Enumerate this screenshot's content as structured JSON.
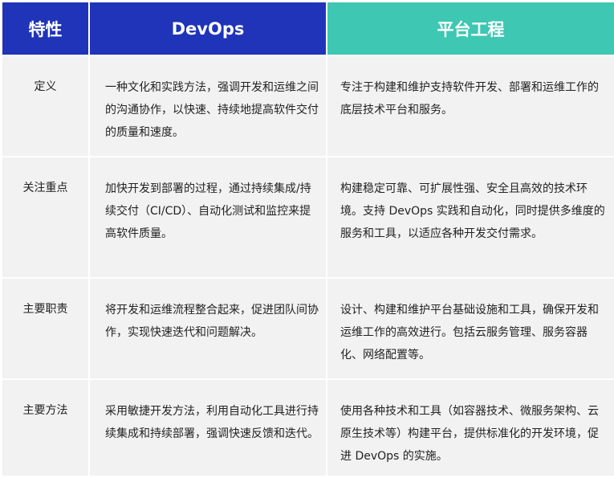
{
  "header": {
    "col1": "特性",
    "col2": "DevOps",
    "col3": "平台工程"
  },
  "rows": [
    {
      "feature": "定义",
      "devops": "一种文化和实践方法，强调开发和运维之间的沟通协作，以快速、持续地提高软件交付的质量和速度。",
      "platform": "专注于构建和维护支持软件开发、部署和运维工作的底层技术平台和服务。"
    },
    {
      "feature": "关注重点",
      "devops": "加快开发到部署的过程，通过持续集成/持续交付（CI/CD）、自动化测试和监控来提高软件质量。",
      "platform": "构建稳定可靠、可扩展性强、安全且高效的技术环境。支持 DevOps 实践和自动化，同时提供多维度的服务和工具，以适应各种开发交付需求。"
    },
    {
      "feature": "主要职责",
      "devops": "将开发和运维流程整合起来，促进团队间协作，实现快速迭代和问题解决。",
      "platform": "设计、构建和维护平台基础设施和工具，确保开发和运维工作的高效进行。包括云服务管理、服务容器化、网络配置等。"
    },
    {
      "feature": "主要方法",
      "devops": "采用敏捷开发方法，利用自动化工具进行持续集成和持续部署，强调快速反馈和迭代。",
      "platform": "使用各种技术和工具（如容器技术、微服务架构、云原生技术等）构建平台，提供标准化的开发环境，促进 DevOps 的实施。"
    }
  ],
  "colors": {
    "header_blue": "#1f34b8",
    "header_teal": "#3ec7b2",
    "row_bg": "#f2f2f2"
  }
}
